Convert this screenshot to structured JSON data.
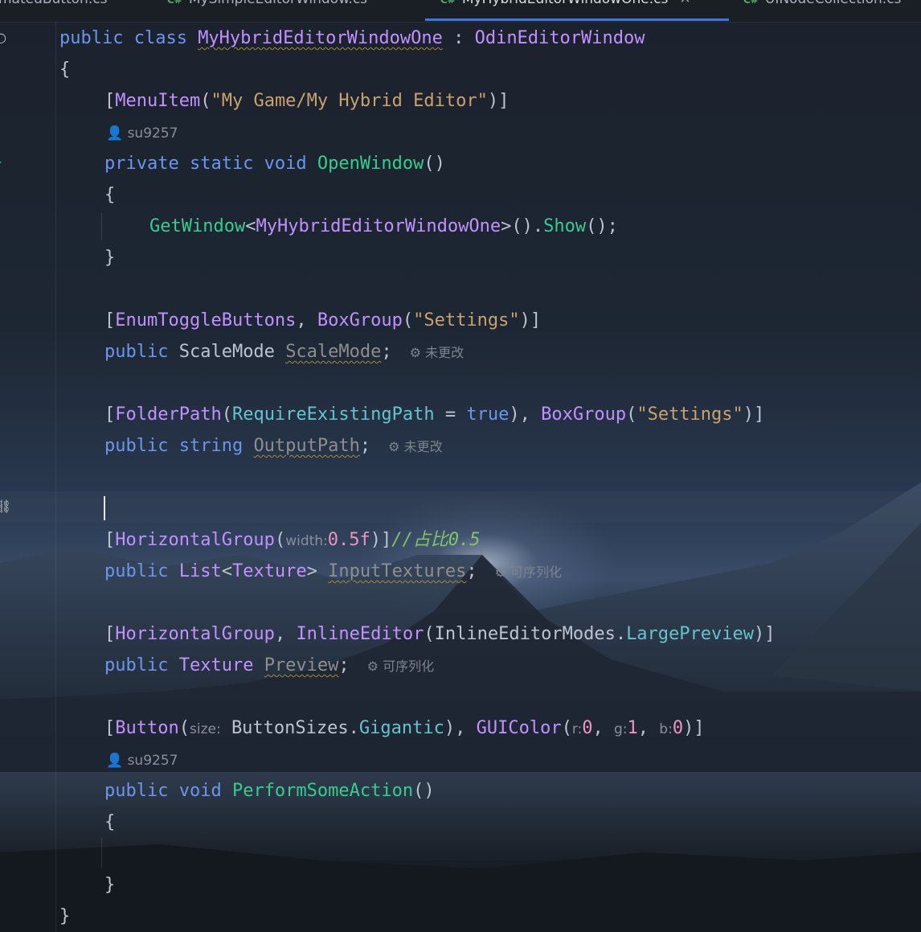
{
  "tabs": [
    {
      "label": "matedButton.cs",
      "active": false
    },
    {
      "label": "MySimpleEditorWindow.cs",
      "active": false
    },
    {
      "label": "MyHybridEditorWindowOne.cs",
      "active": true
    },
    {
      "label": "UINodeCollection.cs",
      "active": false
    }
  ],
  "code": {
    "l1": {
      "kw": "public class ",
      "name": "MyHybridEditorWindowOne",
      "sep": " : ",
      "base": "OdinEditorWindow"
    },
    "l2": "{",
    "l3": {
      "a": "[",
      "attr": "MenuItem",
      "b": "(",
      "str": "\"My Game/My Hybrid Editor\"",
      "c": ")]"
    },
    "lens1": "su9257",
    "l4": {
      "kw": "private static void ",
      "fn": "OpenWindow",
      "rest": "()"
    },
    "l5": "{",
    "l6": {
      "fn": "GetWindow",
      "a": "<",
      "type": "MyHybridEditorWindowOne",
      "b": ">().",
      "fn2": "Show",
      "c": "();"
    },
    "l7": "}",
    "l8": {
      "a": "[",
      "attr": "EnumToggleButtons",
      "b": ", ",
      "attr2": "BoxGroup",
      "c": "(",
      "str": "\"Settings\"",
      "d": ")]"
    },
    "l9": {
      "kw": "public ",
      "type": "ScaleMode",
      "sp": " ",
      "field": "ScaleMode",
      "end": ";",
      "inlay": "未更改"
    },
    "l10": {
      "a": "[",
      "attr": "FolderPath",
      "b": "(",
      "prop": "RequireExistingPath",
      "eq": " = ",
      "bool": "true",
      "c": "), ",
      "attr2": "BoxGroup",
      "d": "(",
      "str": "\"Settings\"",
      "e": ")]"
    },
    "l11": {
      "kw": "public string ",
      "field": "OutputPath",
      "end": ";",
      "inlay": "未更改"
    },
    "l12": {
      "a": "[",
      "attr": "HorizontalGroup",
      "b": "(",
      "hint": "width:",
      "num": "0.5f",
      "c": ")]",
      "cmt": "//占比0.5"
    },
    "l13": {
      "kw": "public ",
      "type": "List",
      "a": "<",
      "type2": "Texture",
      "b": "> ",
      "field": "InputTextures",
      "end": ";",
      "inlay": "可序列化"
    },
    "l14": {
      "a": "[",
      "attr": "HorizontalGroup",
      "b": ", ",
      "attr2": "InlineEditor",
      "c": "(",
      "type": "InlineEditorModes",
      "d": ".",
      "prop": "LargePreview",
      "e": ")]"
    },
    "l15": {
      "kw": "public ",
      "type": "Texture",
      "sp": " ",
      "field": "Preview",
      "end": ";",
      "inlay": "可序列化"
    },
    "l16": {
      "a": "[",
      "attr": "Button",
      "b": "(",
      "hint1": "size:",
      "type": "ButtonSizes",
      "d": ".",
      "prop": "Gigantic",
      "e": "), ",
      "attr2": "GUIColor",
      "f": "(",
      "hint_r": "r:",
      "num_r": "0",
      "g": ", ",
      "hint_g": "g:",
      "num_g": "1",
      "h": ", ",
      "hint_b": "b:",
      "num_b": "0",
      "i": ")]"
    },
    "lens2": "su9257",
    "l17": {
      "kw": "public void ",
      "fn": "PerformSomeAction",
      "rest": "()"
    },
    "l18": "{",
    "l19": "}",
    "l20": "}"
  },
  "colors": {
    "keyword": "#6c95eb",
    "class": "#c191ff",
    "string": "#c9a26d",
    "method": "#39cc8f",
    "comment": "#84c26a",
    "tab_accent": "#3b78e7"
  }
}
